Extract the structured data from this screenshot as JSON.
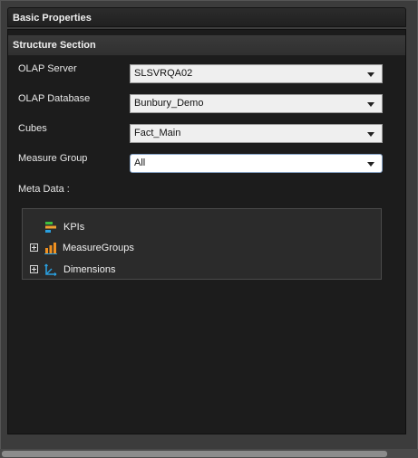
{
  "panel": {
    "title": "Basic Properties"
  },
  "section": {
    "title": "Structure Section"
  },
  "fields": {
    "olap_server": {
      "label": "OLAP Server",
      "value": "SLSVRQA02"
    },
    "olap_database": {
      "label": "OLAP Database",
      "value": "Bunbury_Demo"
    },
    "cubes": {
      "label": "Cubes",
      "value": "Fact_Main"
    },
    "measure_group": {
      "label": "Measure Group",
      "value": "All"
    }
  },
  "meta": {
    "label": "Meta Data :",
    "items": [
      {
        "label": "KPIs",
        "icon": "kpi-icon",
        "expandable": false
      },
      {
        "label": "MeasureGroups",
        "icon": "bar-chart-icon",
        "expandable": true
      },
      {
        "label": "Dimensions",
        "icon": "axes-icon",
        "expandable": true
      }
    ]
  },
  "colors": {
    "panel_bg": "#1c1c1c",
    "header_bg": "#2a2a2a",
    "tree_bg": "#2b2b2b",
    "kpi_green": "#3fbf3f",
    "kpi_orange": "#f0a030",
    "bar_orange": "#f09020",
    "axis_blue": "#2aa0e0"
  }
}
